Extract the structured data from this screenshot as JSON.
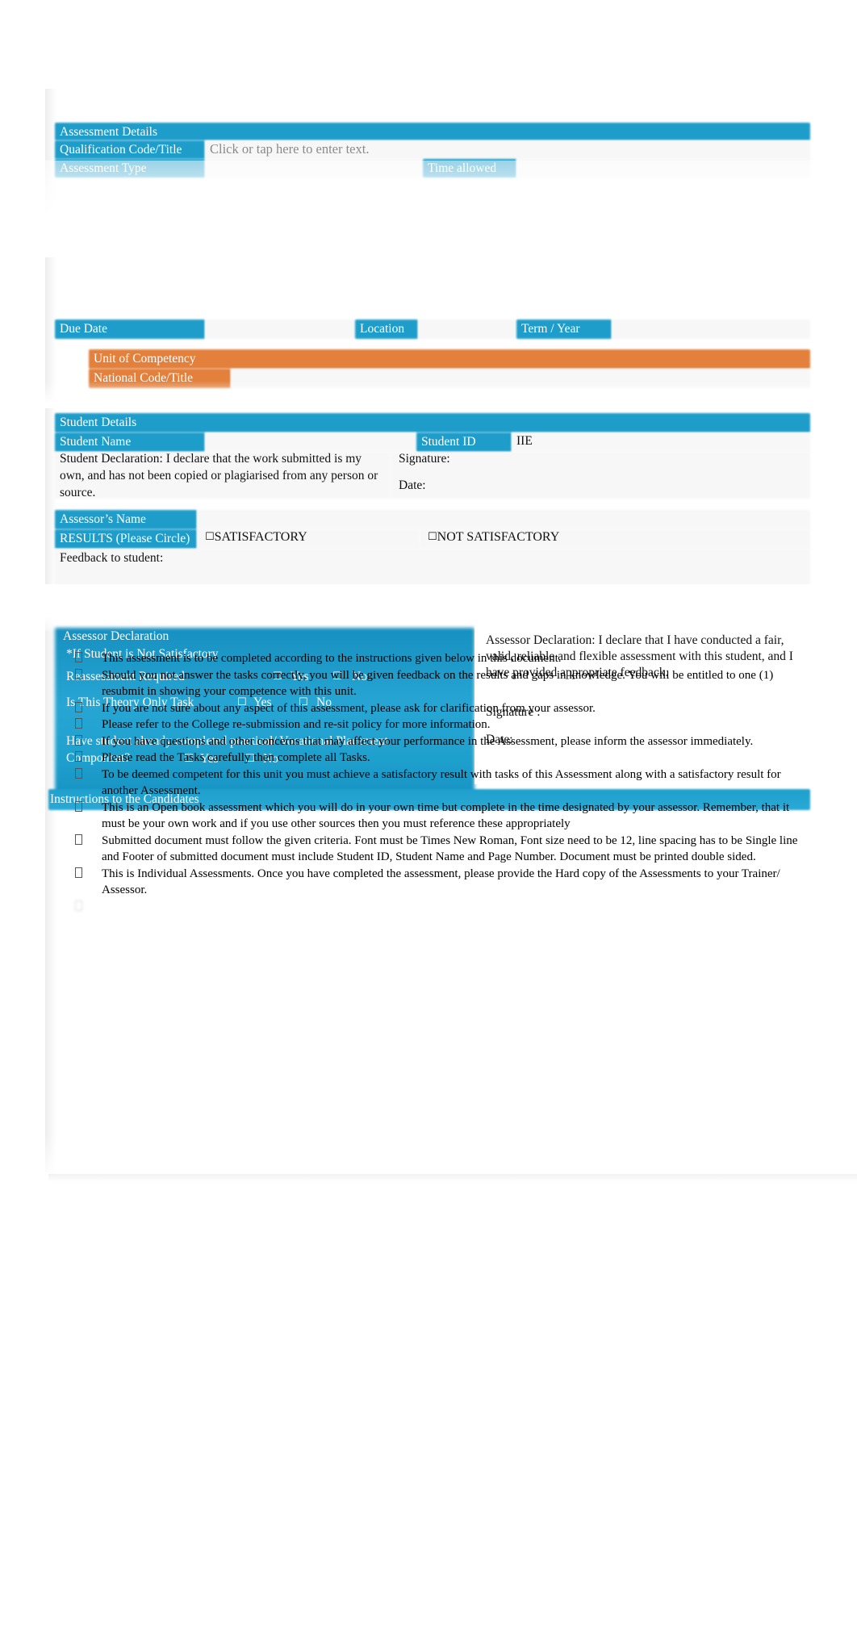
{
  "document": {
    "type": "assessment-cover-sheet"
  },
  "colors": {
    "header_blue": "#1f9dca",
    "header_orange": "#e2803c",
    "field_grey": "#f7f7f7",
    "text": "#000000",
    "header_text": "#ffffff"
  },
  "assessment_details": {
    "section_title": "Assessment Details",
    "qualification_label": "Qualification Code/Title",
    "qualification_placeholder": "Click or tap here to enter text.",
    "qualification_value": "",
    "assessment_type_label": "Assessment Type",
    "assessment_type_value": "",
    "time_allowed_label": "Time allowed",
    "time_allowed_value": ""
  },
  "schedule": {
    "due_date_label": "Due Date",
    "due_date_value": "",
    "location_label": "Location",
    "location_value": "",
    "term_year_label": "Term / Year",
    "term_year_value": ""
  },
  "unit": {
    "unit_of_competency_label": "Unit of Competency",
    "national_code_label": "National Code/Title",
    "unit_of_competency_value": "",
    "national_code_value": ""
  },
  "student_details": {
    "section_title": "Student Details",
    "student_name_label": "Student Name",
    "student_name_value": "",
    "student_id_label": "Student ID",
    "student_id_value": "IIE",
    "declaration_text": "Student Declaration:   I declare that the work submitted is my own, and has not been copied or plagiarised from any person or source.",
    "signature_label": "Signature:",
    "date_label": "Date:"
  },
  "results": {
    "assessor_name_label": "Assessor’s Name",
    "assessor_name_value": "",
    "results_label": "RESULTS (Please Circle)",
    "satisfactory_label": "SATISFACTORY",
    "not_satisfactory_label": "NOT SATISFACTORY",
    "checkbox_glyph": "☐",
    "feedback_label": "Feedback to student:",
    "feedback_value": ""
  },
  "assessor_declaration": {
    "section_title": "Assessor Declaration",
    "not_satisfactory_note": "*If Student is Not Satisfactory",
    "reassessment_label": "Reassessment Required",
    "reassessment_yes": "Yes",
    "reassessment_no": "No",
    "theory_only_label": "Is This Theory Only Task",
    "theory_only_yes": "Yes",
    "theory_only_no": "No",
    "placement_label": "Have student already completed practical/ Vocational Placement Component?",
    "placement_yes": "Yes",
    "placement_no": "No",
    "checkbox_glyph": "☐",
    "declaration_text": "Assessor Declaration:  I declare that I have conducted a fair, valid, reliable and flexible assessment with this student, and I have provided appropriate feedback.",
    "signature_label": "Signature :",
    "date_label": "Date:"
  },
  "instructions": {
    "section_title": "Instructions to the Candidates",
    "items": [
      "This assessment is to be completed according to the instructions given below in this document.",
      "Should you not answer the tasks correctly, you will be given feedback on the results and gaps in knowledge. You will be entitled to one (1) resubmit in showing your competence with this unit.",
      "If you are not sure about any aspect of this assessment, please ask for clarification from your assessor.",
      "Please refer to the College re-submission and re-sit policy for more information.",
      "If you have questions and other concerns that may affect your performance in the Assessment, please inform the assessor immediately.",
      "Please read the Tasks carefully then complete all Tasks.",
      "To be deemed competent for this unit you must achieve a satisfactory result with tasks of this Assessment along with a satisfactory result for another Assessment.",
      "This is an Open book assessment which you will do in your own time but complete in the time designated by your assessor. Remember, that it must be your own work and if you use other sources then you must reference these appropriately",
      "Submitted document must follow the given criteria. Font must be Times New Roman, Font size need to be 12, line spacing has to be Single line and Footer of submitted document must include Student ID, Student Name and Page Number. Document must be printed double sided.",
      "This is Individual Assessments. Once you have completed the assessment, please provide the Hard copy of the Assessments to your Trainer/ Assessor."
    ],
    "truncated_item": ""
  }
}
